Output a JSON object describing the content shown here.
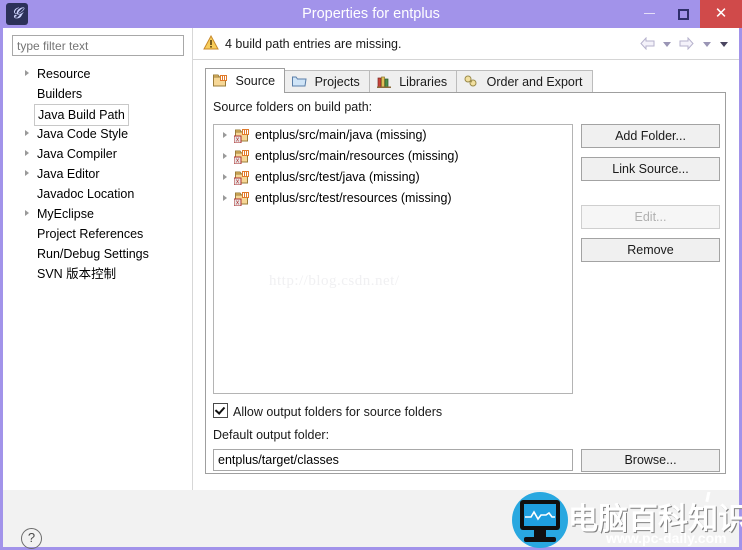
{
  "window": {
    "title": "Properties for entplus",
    "icon": "eclipse-app-icon",
    "minimize_label": "–",
    "maximize_label": "□",
    "close_label": "✕"
  },
  "sidebar": {
    "filter_placeholder": "type filter text",
    "filter_value": "",
    "items": [
      {
        "label": "Resource",
        "expandable": true,
        "selected": false
      },
      {
        "label": "Builders",
        "expandable": false,
        "selected": false
      },
      {
        "label": "Java Build Path",
        "expandable": false,
        "selected": true
      },
      {
        "label": "Java Code Style",
        "expandable": true,
        "selected": false
      },
      {
        "label": "Java Compiler",
        "expandable": true,
        "selected": false
      },
      {
        "label": "Java Editor",
        "expandable": true,
        "selected": false
      },
      {
        "label": "Javadoc Location",
        "expandable": false,
        "selected": false
      },
      {
        "label": "MyEclipse",
        "expandable": true,
        "selected": false
      },
      {
        "label": "Project References",
        "expandable": false,
        "selected": false
      },
      {
        "label": "Run/Debug Settings",
        "expandable": false,
        "selected": false
      },
      {
        "label": "SVN 版本控制",
        "expandable": false,
        "selected": false
      }
    ]
  },
  "message_bar": {
    "icon": "warning-icon",
    "text": "4 build path entries are missing.",
    "nav": {
      "back_icon": "arrow-left-icon",
      "back_menu_icon": "chevron-down-icon",
      "forward_icon": "arrow-right-icon",
      "forward_menu_icon": "chevron-down-icon",
      "menu_icon": "chevron-down-icon"
    }
  },
  "tabs": [
    {
      "label": "Source",
      "icon": "source-folder-icon",
      "active": true
    },
    {
      "label": "Projects",
      "icon": "projects-folder-icon",
      "active": false
    },
    {
      "label": "Libraries",
      "icon": "libraries-books-icon",
      "active": false
    },
    {
      "label": "Order and Export",
      "icon": "order-export-icon",
      "active": false
    }
  ],
  "source_tab": {
    "list_label": "Source folders on build path:",
    "entries": [
      {
        "label": "entplus/src/main/java (missing)",
        "icon": "source-folder-error-icon"
      },
      {
        "label": "entplus/src/main/resources (missing)",
        "icon": "source-folder-error-icon"
      },
      {
        "label": "entplus/src/test/java (missing)",
        "icon": "source-folder-error-icon"
      },
      {
        "label": "entplus/src/test/resources (missing)",
        "icon": "source-folder-error-icon"
      }
    ],
    "watermark": "http://blog.csdn.net/",
    "buttons": [
      {
        "id": "add-folder",
        "label": "Add Folder...",
        "enabled": true
      },
      {
        "id": "link-source",
        "label": "Link Source...",
        "enabled": true
      },
      {
        "id": "edit",
        "label": "Edit...",
        "enabled": false
      },
      {
        "id": "remove",
        "label": "Remove",
        "enabled": true
      }
    ],
    "allow_output_label": "Allow output folders for source folders",
    "allow_output_checked": true,
    "default_output_label": "Default output folder:",
    "default_output_value": "entplus/target/classes",
    "browse_label": "Browse..."
  },
  "footer": {
    "help_icon": "help-question-icon",
    "help_glyph": "?"
  },
  "watermark_logo": {
    "icon": "monitor-pulse-icon",
    "brand_cn": "电脑百科知识",
    "brand_url": "www.pc-daily.com"
  },
  "colors": {
    "titlebar": "#a293ea",
    "close_button": "#d04a4a",
    "dialog_bg": "#ffffff",
    "footer_bg": "#f2f2f2",
    "logo_blue": "#29a8e0",
    "warning_amber": "#e8a317"
  }
}
